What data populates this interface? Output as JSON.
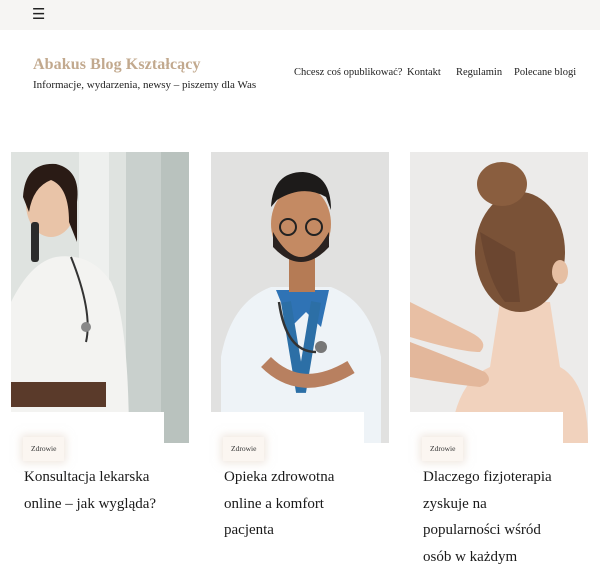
{
  "header": {
    "menu_icon": "menu-icon",
    "site_title": "Abakus Blog Kształcący",
    "tagline": "Informacje, wydarzenia, newsy – piszemy dla Was"
  },
  "nav": {
    "items": [
      {
        "label": "Chcesz coś opublikować?"
      },
      {
        "label": "Kontakt"
      },
      {
        "label": "Regulamin"
      },
      {
        "label": "Polecane blogi"
      }
    ]
  },
  "posts": [
    {
      "category": "Zdrowie",
      "title": "Konsultacja lekarska online – jak wygląda?"
    },
    {
      "category": "Zdrowie",
      "title": "Opieka zdrowotna online a komfort pacjenta"
    },
    {
      "category": "Zdrowie",
      "title": "Dlaczego fizjoterapia zyskuje na popularności wśród osób w każdym"
    }
  ],
  "colors": {
    "topbar": "#f6f5f3",
    "brand_title": "#c2a98e",
    "badge_bg": "#fbf6f1"
  }
}
